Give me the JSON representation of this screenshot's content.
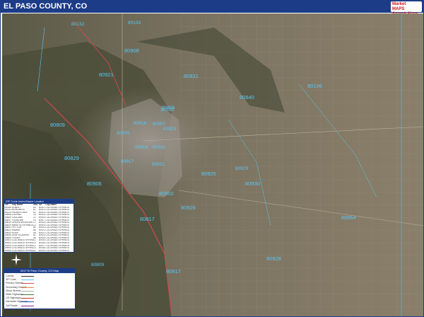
{
  "title": "EL PASO COUNTY, CO",
  "logo": {
    "line1": "Market",
    "line2": "MAPS",
    "line3": "Search Maps"
  },
  "zip_labels": [
    {
      "text": "80132",
      "big": false
    },
    {
      "text": "80133",
      "big": false
    },
    {
      "text": "80908",
      "big": true
    },
    {
      "text": "80921",
      "big": true
    },
    {
      "text": "80831",
      "big": true
    },
    {
      "text": "80106",
      "big": true
    },
    {
      "text": "80840",
      "big": true
    },
    {
      "text": "80808",
      "big": true
    },
    {
      "text": "80920",
      "big": false
    },
    {
      "text": "80918",
      "big": false
    },
    {
      "text": "80809",
      "big": true
    },
    {
      "text": "80829",
      "big": true
    },
    {
      "text": "80906",
      "big": true
    },
    {
      "text": "80905",
      "big": false
    },
    {
      "text": "80915",
      "big": false
    },
    {
      "text": "80916",
      "big": false
    },
    {
      "text": "80910",
      "big": false
    },
    {
      "text": "80911",
      "big": false
    },
    {
      "text": "80925",
      "big": true
    },
    {
      "text": "80929",
      "big": false
    },
    {
      "text": "80930",
      "big": true
    },
    {
      "text": "80864",
      "big": true
    },
    {
      "text": "80817",
      "big": true
    },
    {
      "text": "80928",
      "big": true
    },
    {
      "text": "80926",
      "big": true
    },
    {
      "text": "80817",
      "big": true
    },
    {
      "text": "80809",
      "big": false
    },
    {
      "text": "80902",
      "big": true
    },
    {
      "text": "80907",
      "big": false
    },
    {
      "text": "80917",
      "big": false
    }
  ],
  "zip_index": {
    "title": "ZIP Code Index/Name Locator",
    "headers": [
      "ZIP",
      "City Name",
      "Grid",
      "ZIP",
      "City Name"
    ],
    "rows": [
      [
        "80106",
        "ELBERT",
        "B3",
        "80911",
        "COLORADO SPRINGS"
      ],
      [
        "80132",
        "MONUMENT",
        "A2",
        "80913",
        "COLORADO SPRINGS"
      ],
      [
        "80133",
        "PALMER LAKE",
        "A2",
        "80914",
        "COLORADO SPRINGS"
      ],
      [
        "80808",
        "CALHAN",
        "C5",
        "80915",
        "COLORADO SPRINGS"
      ],
      [
        "80809",
        "CASCADE",
        "C2",
        "80916",
        "COLORADO SPRINGS"
      ],
      [
        "80817",
        "FOUNTAIN",
        "E3",
        "80917",
        "COLORADO SPRINGS"
      ],
      [
        "80819",
        "GREEN MOUNTAIN FALLS",
        "C2",
        "80918",
        "COLORADO SPRINGS"
      ],
      [
        "80829",
        "MANITOU SPRINGS",
        "C2",
        "80919",
        "COLORADO SPRINGS"
      ],
      [
        "80831",
        "PEYTON",
        "B4",
        "80920",
        "COLORADO SPRINGS"
      ],
      [
        "80832",
        "RAMAH",
        "B6",
        "80921",
        "COLORADO SPRINGS"
      ],
      [
        "80833",
        "RUSH",
        "D6",
        "80922",
        "COLORADO SPRINGS"
      ],
      [
        "80840",
        "USAF ACADEMY",
        "B2",
        "80923",
        "COLORADO SPRINGS"
      ],
      [
        "80864",
        "YODER",
        "D5",
        "80924",
        "COLORADO SPRINGS"
      ],
      [
        "80902",
        "COLORADO SPRINGS",
        "E2",
        "80925",
        "COLORADO SPRINGS"
      ],
      [
        "80903",
        "COLORADO SPRINGS",
        "C3",
        "80926",
        "COLORADO SPRINGS"
      ],
      [
        "80904",
        "COLORADO SPRINGS",
        "C2",
        "80927",
        "COLORADO SPRINGS"
      ],
      [
        "80905",
        "COLORADO SPRINGS",
        "C3",
        "80928",
        "COLORADO SPRINGS"
      ],
      [
        "80906",
        "COLORADO SPRINGS",
        "D2",
        "80929",
        "COLORADO SPRINGS"
      ],
      [
        "80907",
        "COLORADO SPRINGS",
        "C3",
        "80930",
        "COLORADO SPRINGS"
      ]
    ]
  },
  "legend": {
    "title": "2017 El Paso County, CO Map",
    "items": [
      "County",
      "ZIP Code",
      "Primary Streets",
      "Secondary Streets",
      "Minor Streets",
      "State Highways",
      "US Highways",
      "Interstate Highways",
      "Toll Roads"
    ],
    "colors": [
      "#333333",
      "#58c7f5",
      "#d04a4a",
      "#e08a3a",
      "#aaaaaa",
      "#3a7d3a",
      "#d03030",
      "#2050c0",
      "#8a2a8a"
    ]
  }
}
